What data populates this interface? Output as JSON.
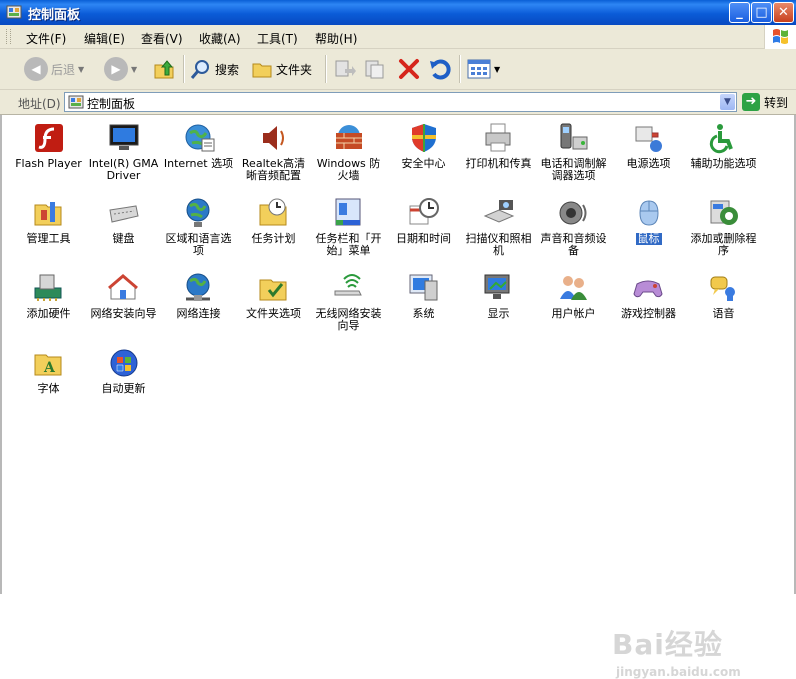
{
  "window": {
    "title": "控制面板",
    "buttons": {
      "minimize": "_",
      "maximize": "□",
      "close": "✕"
    }
  },
  "menu": [
    "文件(F)",
    "编辑(E)",
    "查看(V)",
    "收藏(A)",
    "工具(T)",
    "帮助(H)"
  ],
  "toolbar": {
    "back_label": "后退",
    "search_label": "搜索",
    "folders_label": "文件夹"
  },
  "address": {
    "label": "地址(D)",
    "value": "控制面板",
    "go_label": "转到"
  },
  "items": [
    {
      "label": "Flash Player",
      "icon": "flash-icon"
    },
    {
      "label": "Intel(R) GMA Driver",
      "icon": "monitor-icon"
    },
    {
      "label": "Internet 选项",
      "icon": "globe-icon"
    },
    {
      "label": "Realtek高清晰音频配置",
      "icon": "speaker-icon"
    },
    {
      "label": "Windows 防火墙",
      "icon": "firewall-icon"
    },
    {
      "label": "安全中心",
      "icon": "shield-icon"
    },
    {
      "label": "打印机和传真",
      "icon": "printer-icon"
    },
    {
      "label": "电话和调制解调器选项",
      "icon": "phone-icon"
    },
    {
      "label": "电源选项",
      "icon": "power-icon"
    },
    {
      "label": "辅助功能选项",
      "icon": "accessibility-icon"
    },
    {
      "label": "管理工具",
      "icon": "admin-tools-icon"
    },
    {
      "label": "键盘",
      "icon": "keyboard-icon"
    },
    {
      "label": "区域和语言选项",
      "icon": "region-globe-icon"
    },
    {
      "label": "任务计划",
      "icon": "scheduled-tasks-icon"
    },
    {
      "label": "任务栏和「开始」菜单",
      "icon": "taskbar-icon"
    },
    {
      "label": "日期和时间",
      "icon": "clock-icon"
    },
    {
      "label": "扫描仪和照相机",
      "icon": "scanner-icon"
    },
    {
      "label": "声音和音频设备",
      "icon": "sound-icon"
    },
    {
      "label": "鼠标",
      "icon": "mouse-icon",
      "selected": true
    },
    {
      "label": "添加或删除程序",
      "icon": "add-remove-icon"
    },
    {
      "label": "添加硬件",
      "icon": "add-hardware-icon"
    },
    {
      "label": "网络安装向导",
      "icon": "network-setup-icon"
    },
    {
      "label": "网络连接",
      "icon": "network-connections-icon"
    },
    {
      "label": "文件夹选项",
      "icon": "folder-options-icon"
    },
    {
      "label": "无线网络安装向导",
      "icon": "wireless-icon"
    },
    {
      "label": "系统",
      "icon": "system-icon"
    },
    {
      "label": "显示",
      "icon": "display-icon"
    },
    {
      "label": "用户帐户",
      "icon": "user-accounts-icon"
    },
    {
      "label": "游戏控制器",
      "icon": "game-controller-icon"
    },
    {
      "label": "语音",
      "icon": "speech-icon"
    },
    {
      "label": "字体",
      "icon": "fonts-icon"
    },
    {
      "label": "自动更新",
      "icon": "windows-update-icon"
    }
  ],
  "watermark": {
    "brand": "Bai经验",
    "url": "jingyan.baidu.com"
  },
  "colors": {
    "titlebar": "#0a5fd6",
    "chrome": "#ece9d8",
    "selection": "#316ac5"
  }
}
